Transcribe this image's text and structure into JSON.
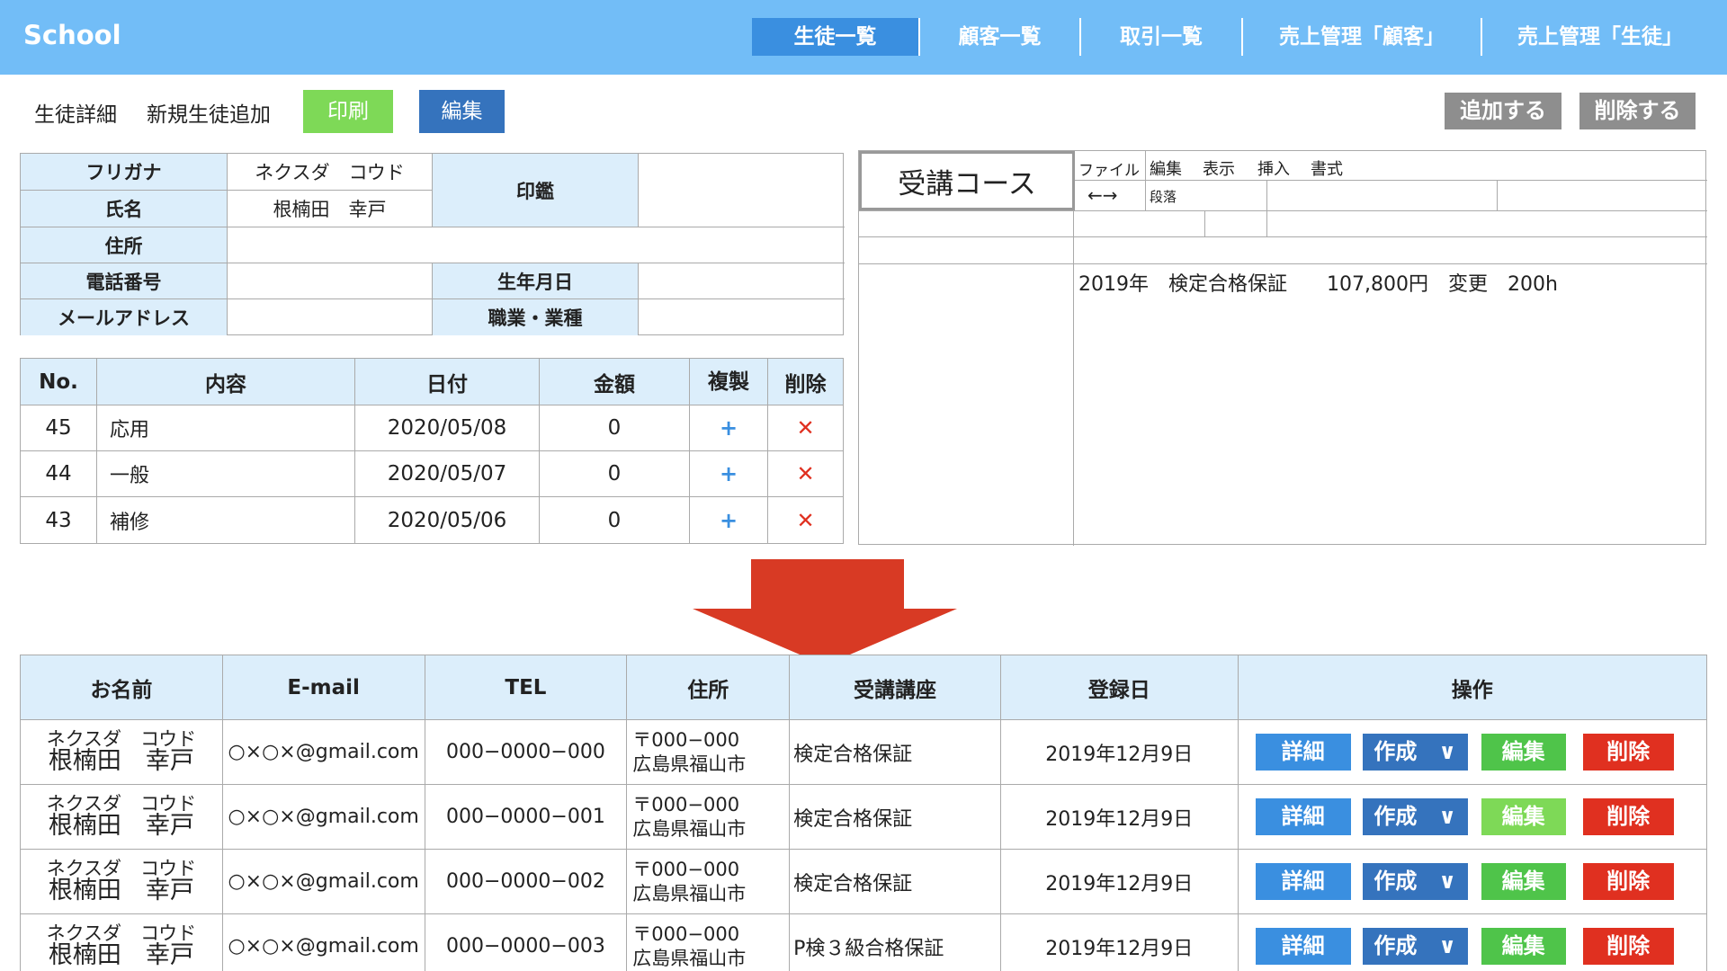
{
  "app": {
    "logo": "School"
  },
  "nav": [
    "生徒一覧",
    "顧客一覧",
    "取引一覧",
    "売上管理「顧客」",
    "売上管理「生徒」"
  ],
  "subtoolbar": {
    "title": "生徒詳細",
    "new_link": "新規生徒追加",
    "print_label": "印刷",
    "edit_label": "編集",
    "add_label": "追加する",
    "delete_label": "削除する"
  },
  "detail": {
    "furigana_label": "フリガナ",
    "furigana_value": "ネクスダ　コウド",
    "name_label": "氏名",
    "name_value": "根楠田　幸戸",
    "seal_label": "印鑑",
    "address_label": "住所",
    "phone_label": "電話番号",
    "birthday_label": "生年月日",
    "email_label": "メールアドレス",
    "occupation_label": "職業・業種"
  },
  "history": {
    "headers": [
      "No.",
      "内容",
      "日付",
      "金額",
      "複製",
      "削除"
    ],
    "rows": [
      {
        "no": "45",
        "content": "応用",
        "date": "2020/05/08",
        "amount": "0"
      },
      {
        "no": "44",
        "content": "一般",
        "date": "2020/05/07",
        "amount": "0"
      },
      {
        "no": "43",
        "content": "補修",
        "date": "2020/05/06",
        "amount": "0"
      }
    ],
    "duplicate_glyph": "+",
    "delete_glyph": "✕"
  },
  "course": {
    "title": "受講コース",
    "menu": [
      "ファイル",
      "編集",
      "表示",
      "挿入",
      "書式"
    ],
    "arrows": "←→",
    "paragraph": "段落",
    "content": "2019年　検定合格保証　　107,800円　変更　200h"
  },
  "list": {
    "headers": [
      "お名前",
      "E-mail",
      "TEL",
      "住所",
      "受講講座",
      "登録日",
      "操作"
    ],
    "rows": [
      {
        "kana": "ネクスダ　コウド",
        "name": "根楠田　幸戸",
        "email": "○×○×@gmail.com",
        "tel": "000−0000−000",
        "zip": "〒000−000",
        "city": "広島県福山市",
        "course": "検定合格保証",
        "date": "2019年12月9日"
      },
      {
        "kana": "ネクスダ　コウド",
        "name": "根楠田　幸戸",
        "email": "○×○×@gmail.com",
        "tel": "000−0000−001",
        "zip": "〒000−000",
        "city": "広島県福山市",
        "course": "検定合格保証",
        "date": "2019年12月9日"
      },
      {
        "kana": "ネクスダ　コウド",
        "name": "根楠田　幸戸",
        "email": "○×○×@gmail.com",
        "tel": "000−0000−002",
        "zip": "〒000−000",
        "city": "広島県福山市",
        "course": "検定合格保証",
        "date": "2019年12月9日"
      },
      {
        "kana": "ネクスダ　コウド",
        "name": "根楠田　幸戸",
        "email": "○×○×@gmail.com",
        "tel": "000−0000−003",
        "zip": "〒000−000",
        "city": "広島県福山市",
        "course": "P検３級合格保証",
        "date": "2019年12月9日"
      }
    ],
    "ops": {
      "detail": "詳細",
      "create": "作成　∨",
      "edit": "編集",
      "delete": "削除"
    }
  },
  "colors": {
    "header": "#72bdf7",
    "nav_active": "#3a8fe0",
    "table_header": "#dceefb",
    "print_button": "#7ed957",
    "edit_button": "#3573bd",
    "delete_button": "#e03020",
    "arrow": "#d83a24",
    "gray_button": "#8e8e8e"
  }
}
